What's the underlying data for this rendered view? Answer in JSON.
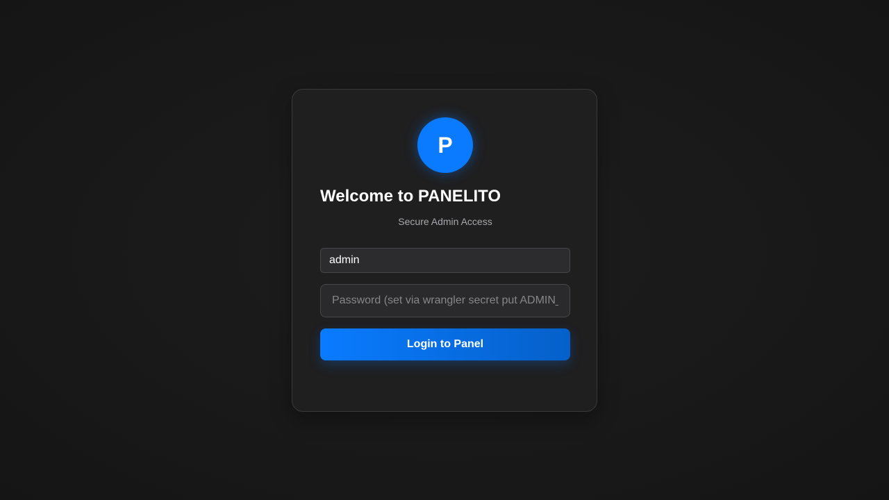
{
  "logo": {
    "letter": "P"
  },
  "header": {
    "title": "Welcome to PANELITO",
    "subtitle": "Secure Admin Access"
  },
  "form": {
    "username_value": "admin",
    "password_placeholder": "Password (set via wrangler secret put ADMIN_PASSWORD)",
    "login_label": "Login to Panel"
  },
  "colors": {
    "accent": "#0a7bff",
    "background": "#1a1a1a",
    "card": "#1f1f20"
  }
}
